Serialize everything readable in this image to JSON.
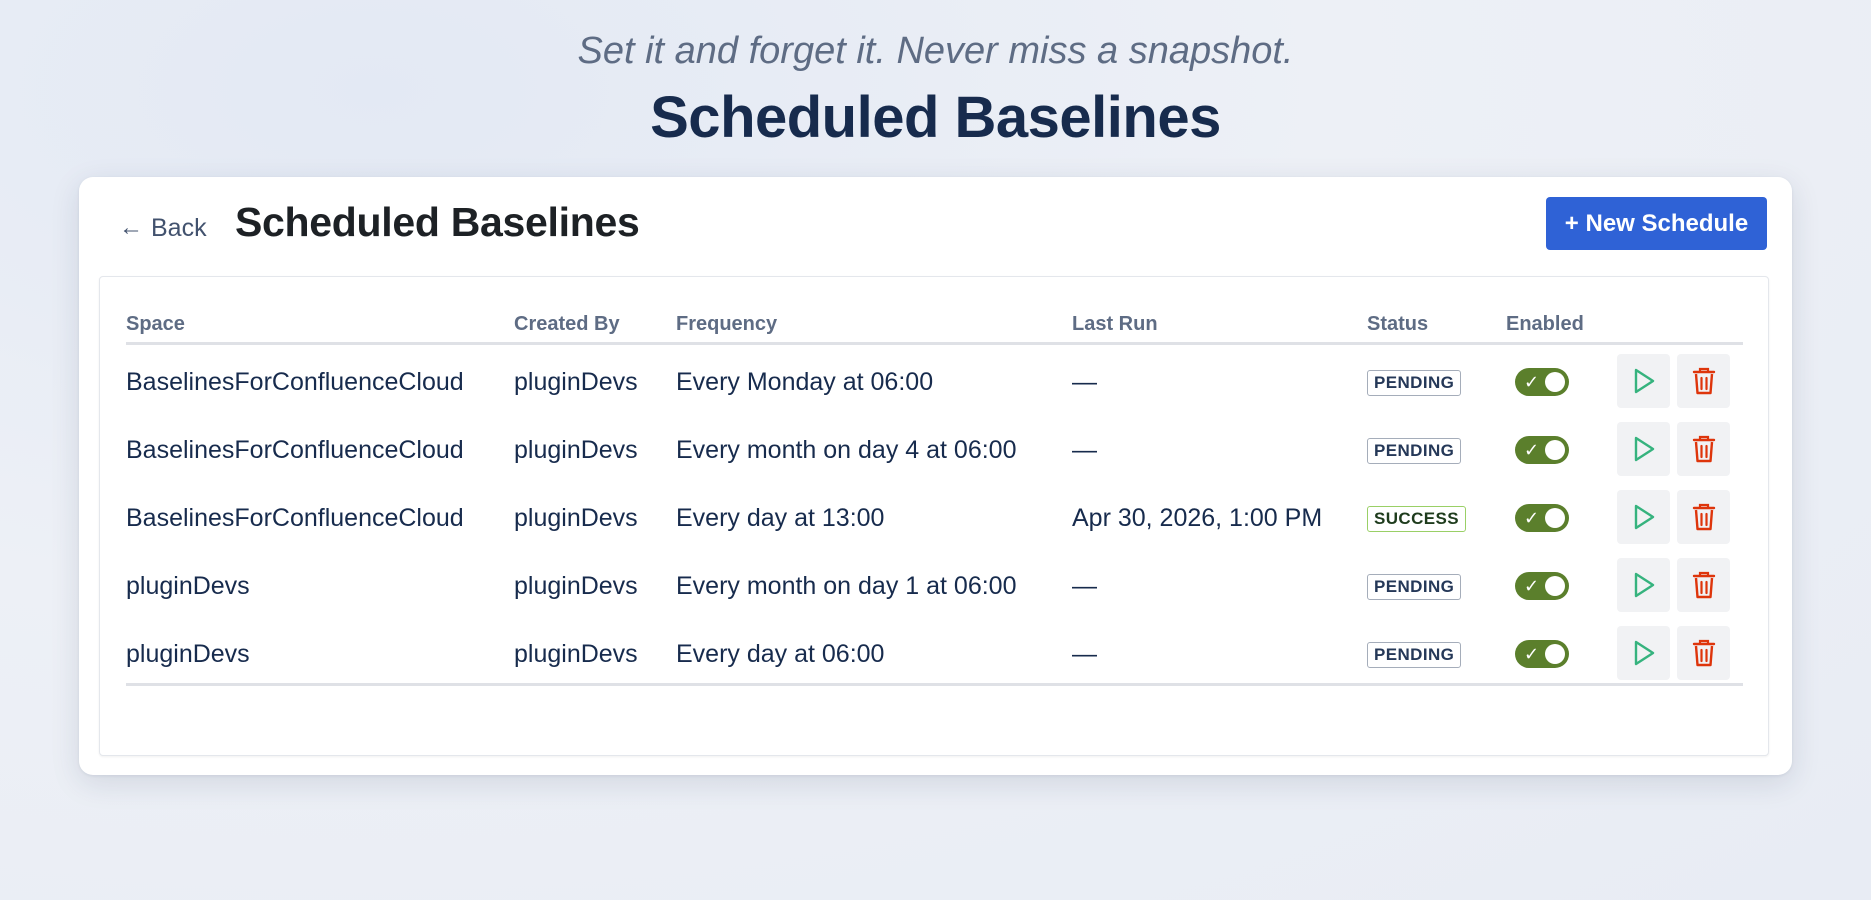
{
  "hero": {
    "tagline": "Set it and forget it. Never miss a snapshot.",
    "title": "Scheduled Baselines"
  },
  "header": {
    "back_label": "Back",
    "back_icon": "arrow-left-icon",
    "title": "Scheduled Baselines",
    "new_button_label": "+ New Schedule"
  },
  "table": {
    "columns": [
      "Space",
      "Created By",
      "Frequency",
      "Last Run",
      "Status",
      "Enabled"
    ],
    "rows": [
      {
        "space": "BaselinesForConfluenceCloud",
        "created_by": "pluginDevs",
        "frequency": "Every Monday at 06:00",
        "last_run": "—",
        "status": "PENDING",
        "enabled": true
      },
      {
        "space": "BaselinesForConfluenceCloud",
        "created_by": "pluginDevs",
        "frequency": "Every month on day 4 at 06:00",
        "last_run": "—",
        "status": "PENDING",
        "enabled": true
      },
      {
        "space": "BaselinesForConfluenceCloud",
        "created_by": "pluginDevs",
        "frequency": "Every day at 13:00",
        "last_run": "Apr 30, 2026, 1:00 PM",
        "status": "SUCCESS",
        "enabled": true
      },
      {
        "space": "pluginDevs",
        "created_by": "pluginDevs",
        "frequency": "Every month on day 1 at 06:00",
        "last_run": "—",
        "status": "PENDING",
        "enabled": true
      },
      {
        "space": "pluginDevs",
        "created_by": "pluginDevs",
        "frequency": "Every day at 06:00",
        "last_run": "—",
        "status": "PENDING",
        "enabled": true
      }
    ],
    "row_actions": {
      "run_icon": "play-icon",
      "delete_icon": "trash-icon"
    }
  },
  "colors": {
    "primary": "#2f62d6",
    "toggle_on": "#5b7f2c",
    "run_icon": "#36b37e",
    "delete_icon": "#de350b",
    "success_border": "#9ad066"
  }
}
